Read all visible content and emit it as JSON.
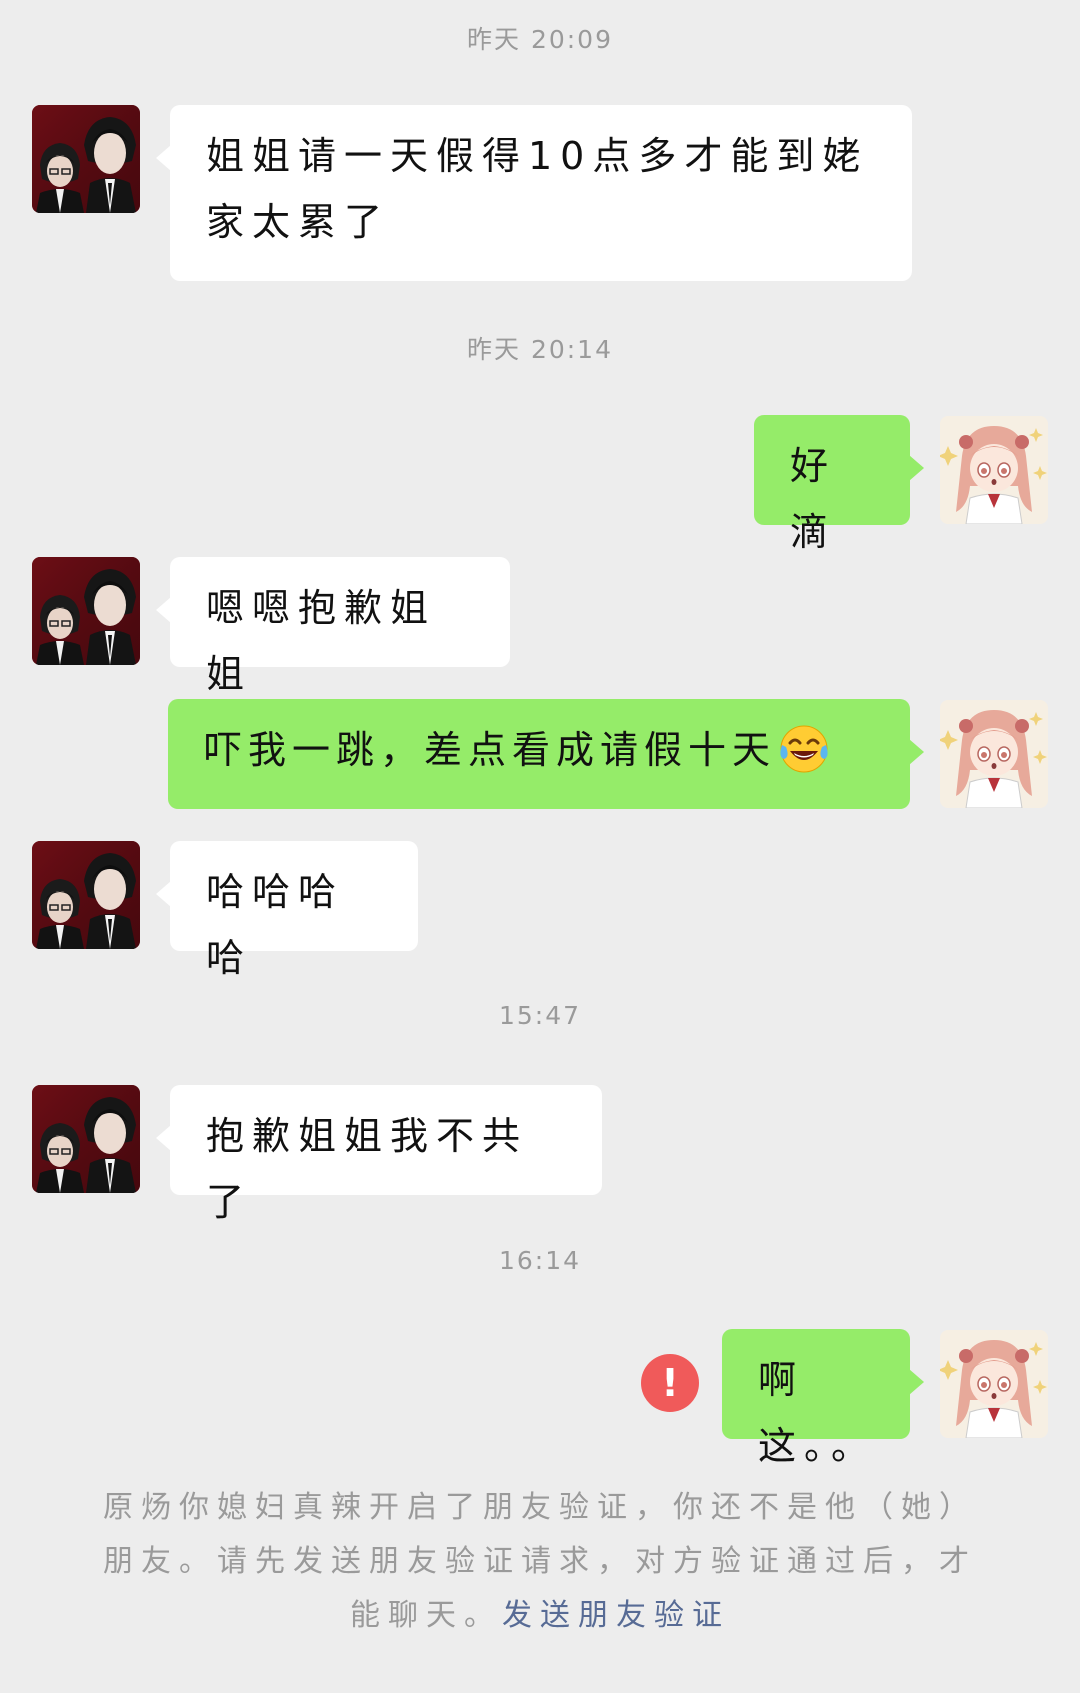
{
  "timestamps": [
    "昨天 20:09",
    "昨天 20:14",
    "15:47",
    "16:14"
  ],
  "messages": [
    {
      "side": "in",
      "text": "姐姐请一天假得10点多才能到姥家太累了"
    },
    {
      "side": "out",
      "text": "好滴"
    },
    {
      "side": "in",
      "text": "嗯嗯抱歉姐姐"
    },
    {
      "side": "out",
      "text": "吓我一跳，差点看成请假十天",
      "emoji": "face-with-tears-of-joy"
    },
    {
      "side": "in",
      "text": "哈哈哈哈"
    },
    {
      "side": "in",
      "text": "抱歉姐姐我不共了"
    },
    {
      "side": "out",
      "text": "啊这。。",
      "status": "failed"
    }
  ],
  "notice": {
    "text": "原炀你媳妇真辣开启了朋友验证，你还不是他（她）朋友。请先发送朋友验证请求，对方验证通过后，才能聊天。",
    "link": "发送朋友验证"
  },
  "icons": {
    "failed": "exclamation-circle-icon",
    "emoji": "tears-of-joy-icon"
  },
  "colors": {
    "background": "#ededed",
    "incoming_bubble": "#ffffff",
    "outgoing_bubble": "#95ec69",
    "error": "#f05a5a",
    "link": "#576b95"
  }
}
